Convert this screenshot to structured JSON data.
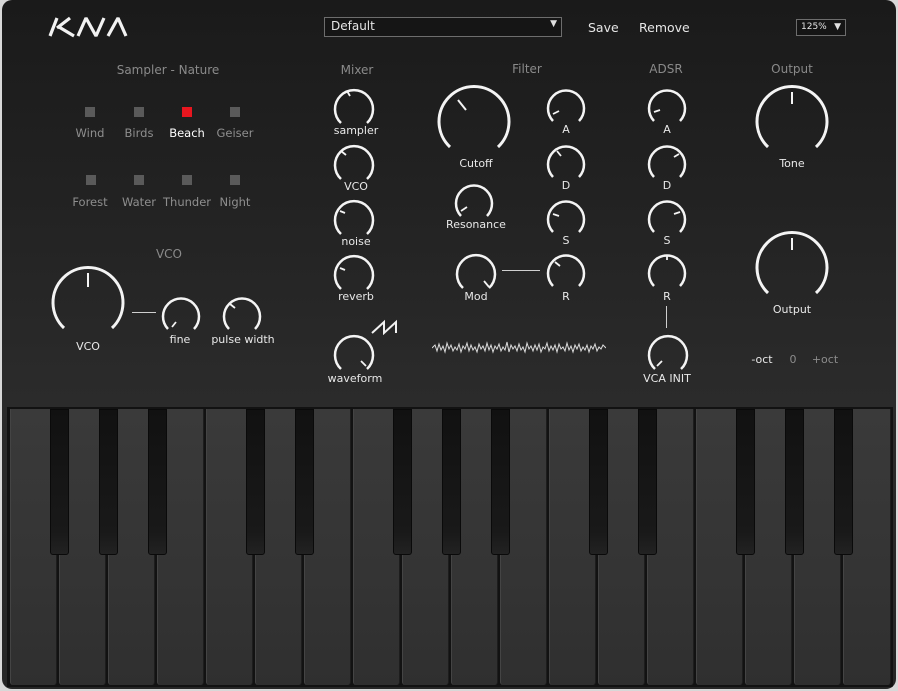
{
  "header": {
    "preset_value": "Default",
    "save_label": "Save",
    "remove_label": "Remove",
    "zoom_value": "125%"
  },
  "sampler": {
    "title": "Sampler - Nature",
    "pads": [
      {
        "label": "Wind",
        "active": false
      },
      {
        "label": "Birds",
        "active": false
      },
      {
        "label": "Beach",
        "active": true
      },
      {
        "label": "Geiser",
        "active": false
      },
      {
        "label": "Forest",
        "active": false
      },
      {
        "label": "Water",
        "active": false
      },
      {
        "label": "Thunder",
        "active": false
      },
      {
        "label": "Night",
        "active": false
      }
    ]
  },
  "vco": {
    "title": "VCO",
    "vco_label": "VCO",
    "fine_label": "fine",
    "pulse_width_label": "pulse width"
  },
  "mixer": {
    "title": "Mixer",
    "sampler_label": "sampler",
    "vco_label": "VCO",
    "noise_label": "noise",
    "reverb_label": "reverb",
    "waveform_label": "waveform"
  },
  "filter": {
    "title": "Filter",
    "cutoff_label": "Cutoff",
    "resonance_label": "Resonance",
    "mod_label": "Mod",
    "a_label": "A",
    "d_label": "D",
    "s_label": "S",
    "r_label": "R"
  },
  "adsr": {
    "title": "ADSR",
    "a_label": "A",
    "d_label": "D",
    "s_label": "S",
    "r_label": "R",
    "vca_init_label": "VCA INIT"
  },
  "output": {
    "title": "Output",
    "tone_label": "Tone",
    "output_label": "Output",
    "oct_down_label": "-oct",
    "oct_value": "0",
    "oct_up_label": "+oct"
  },
  "icons": {
    "logo": "kia-logo",
    "sawtooth": "sawtooth-wave-icon",
    "noise_display": "noise-waveform-display"
  },
  "colors": {
    "accent_red": "#e8161f",
    "panel_bg": "#1e1e1e",
    "text": "#e8e8e8",
    "muted": "#8a8a8a"
  }
}
